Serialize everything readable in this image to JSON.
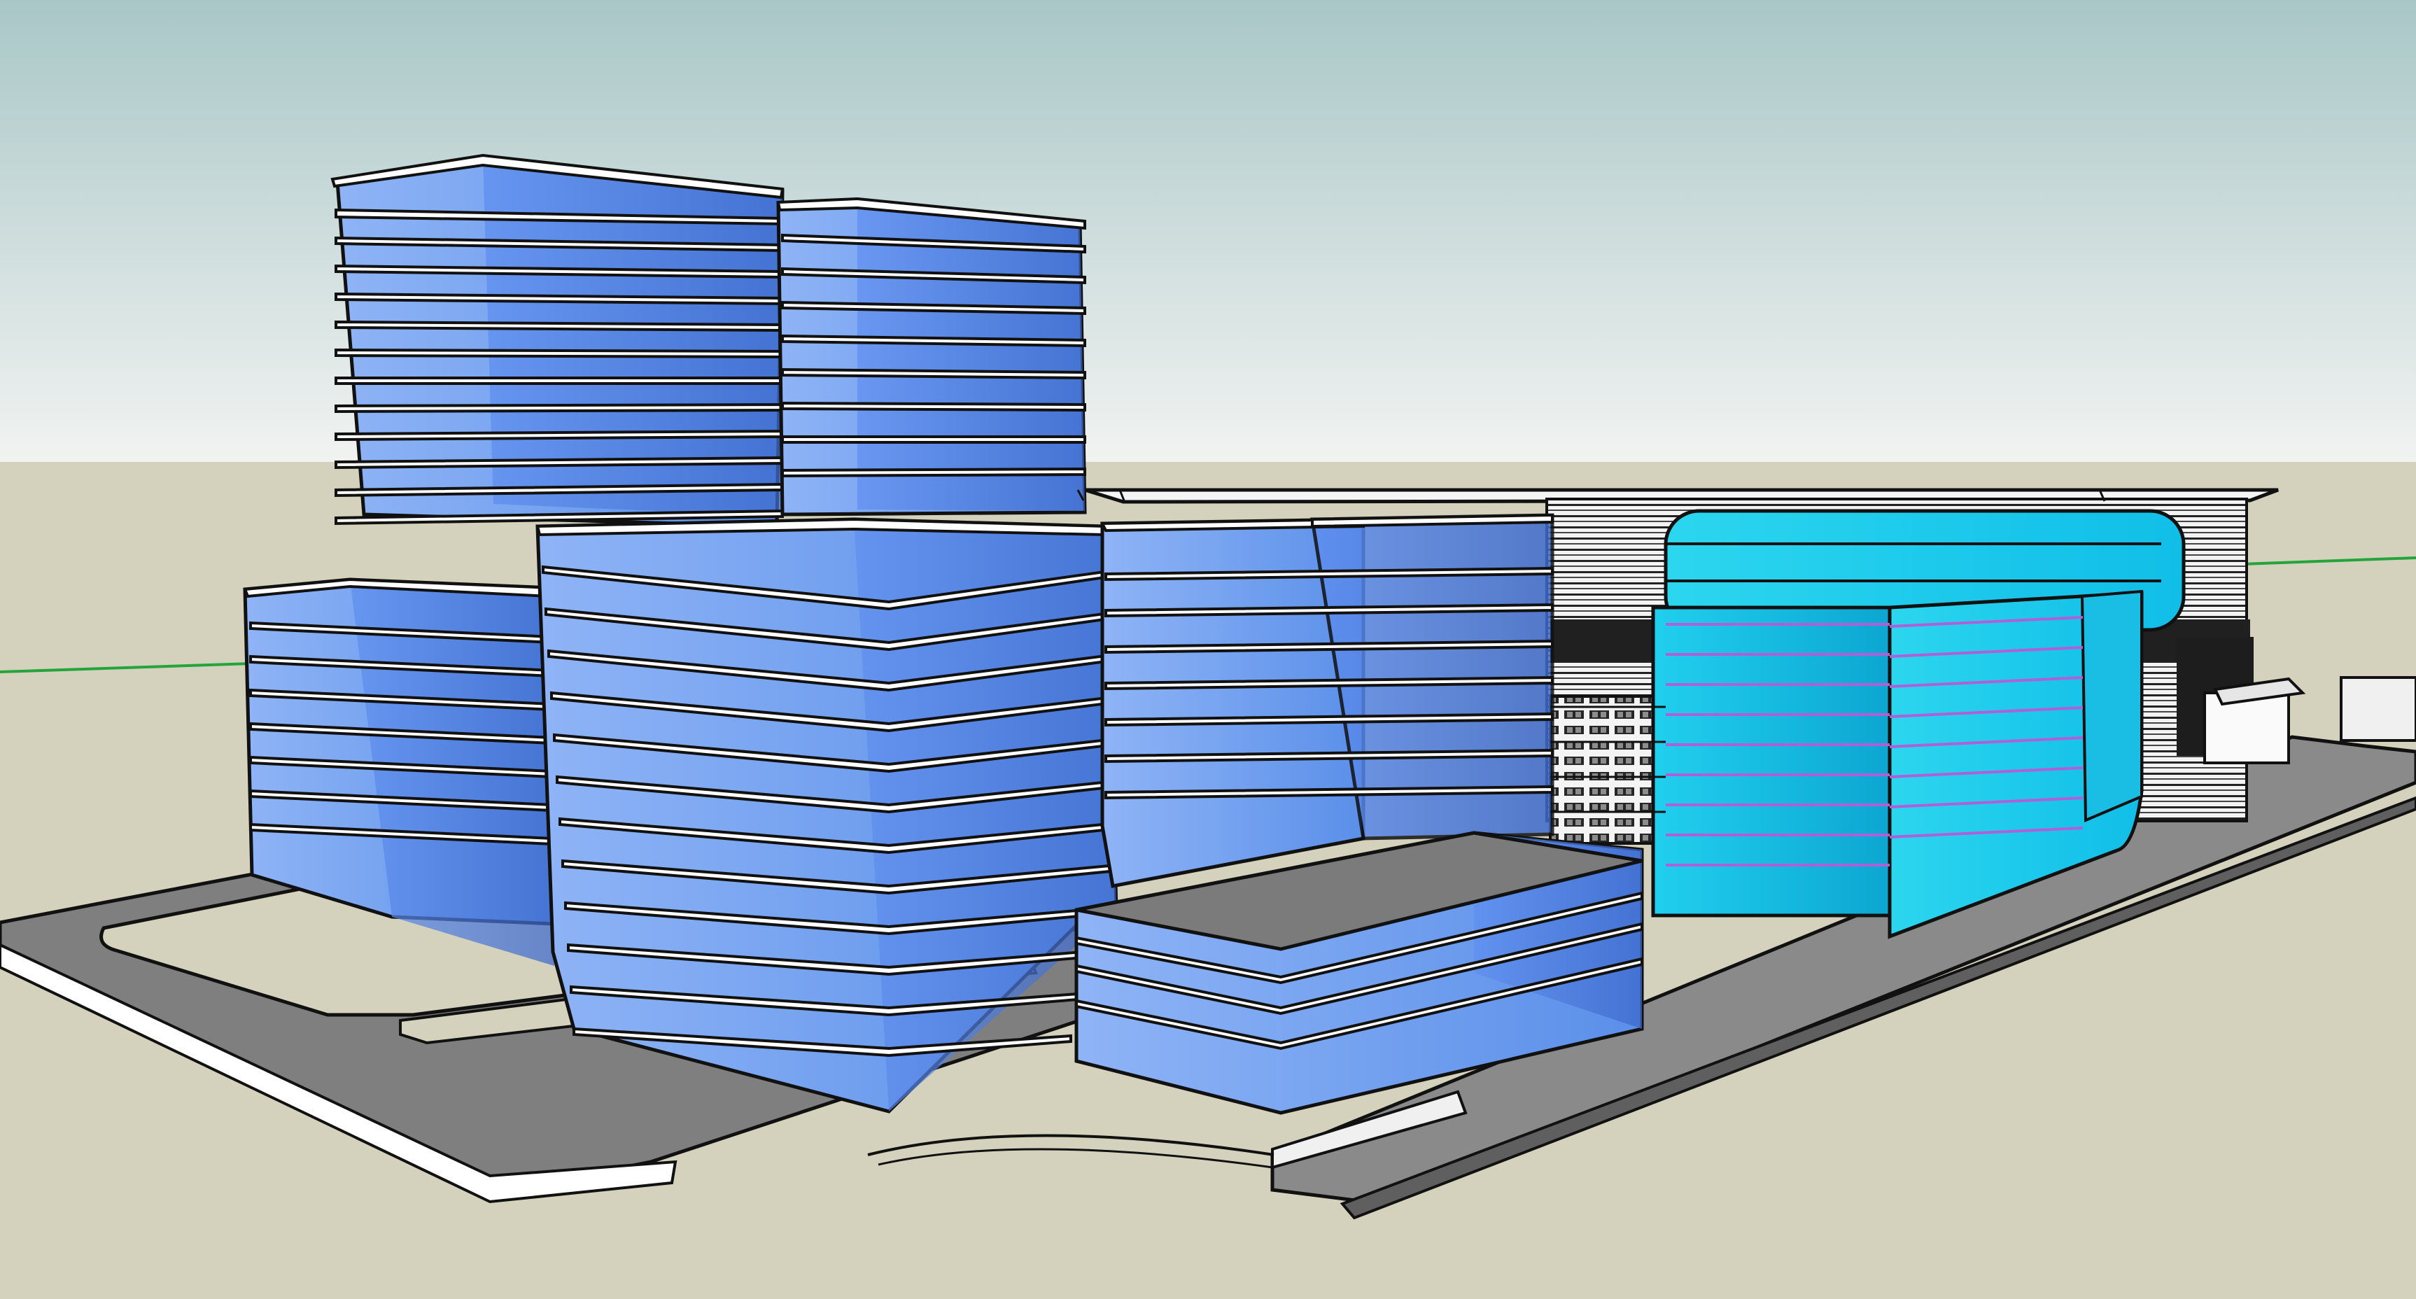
{
  "app": {
    "window_title": ""
  },
  "scene": {
    "description_visible_text": "",
    "colors": {
      "sky_top": "#a9c7c7",
      "sky_bottom": "#f1f3f1",
      "ground": "#d4d1bc",
      "road": "#8f8f8f",
      "road_edge": "#ffffff",
      "roof": "#7f7f7f",
      "blue_glass_light": "#7fa8f3",
      "blue_glass_mid": "#5b8eea",
      "blue_glass_dark": "#4a76d6",
      "cyan_glass_light": "#26d9f4",
      "cyan_glass_mid": "#11c4e9",
      "cyan_glass_dark": "#0ba8d2",
      "outline": "#111111",
      "slab": "#ffffff",
      "green_axis": "#24a43b"
    },
    "icons": []
  }
}
